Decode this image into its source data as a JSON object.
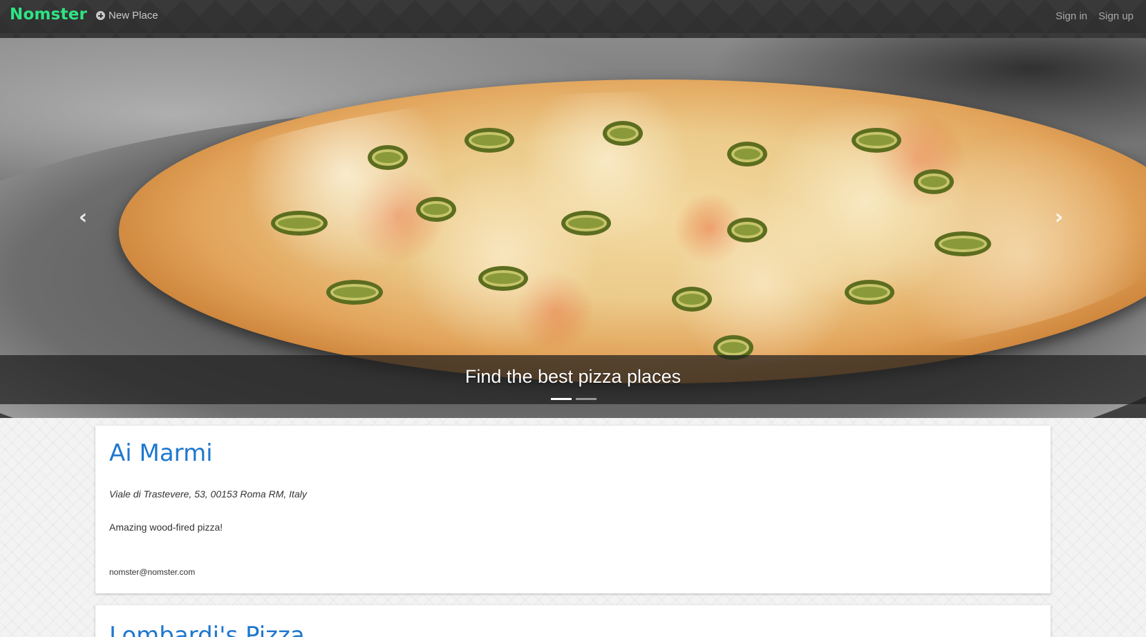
{
  "navbar": {
    "brand": "Nomster",
    "new_place_label": "New Place",
    "sign_in_label": "Sign in",
    "sign_up_label": "Sign up"
  },
  "carousel": {
    "caption": "Find the best pizza places",
    "slide_count": 2,
    "active_slide": 1,
    "prev_icon": "chevron-left-icon",
    "next_icon": "chevron-right-icon"
  },
  "places": [
    {
      "name": "Ai Marmi",
      "address": "Viale di Trastevere, 53, 00153 Roma RM, Italy",
      "description": "Amazing wood-fired pizza!",
      "email": "nomster@nomster.com"
    },
    {
      "name": "Lombardi's Pizza"
    }
  ],
  "colors": {
    "brand": "#2ee584",
    "navbar_bg": "#333333",
    "link": "#1f77cf"
  }
}
